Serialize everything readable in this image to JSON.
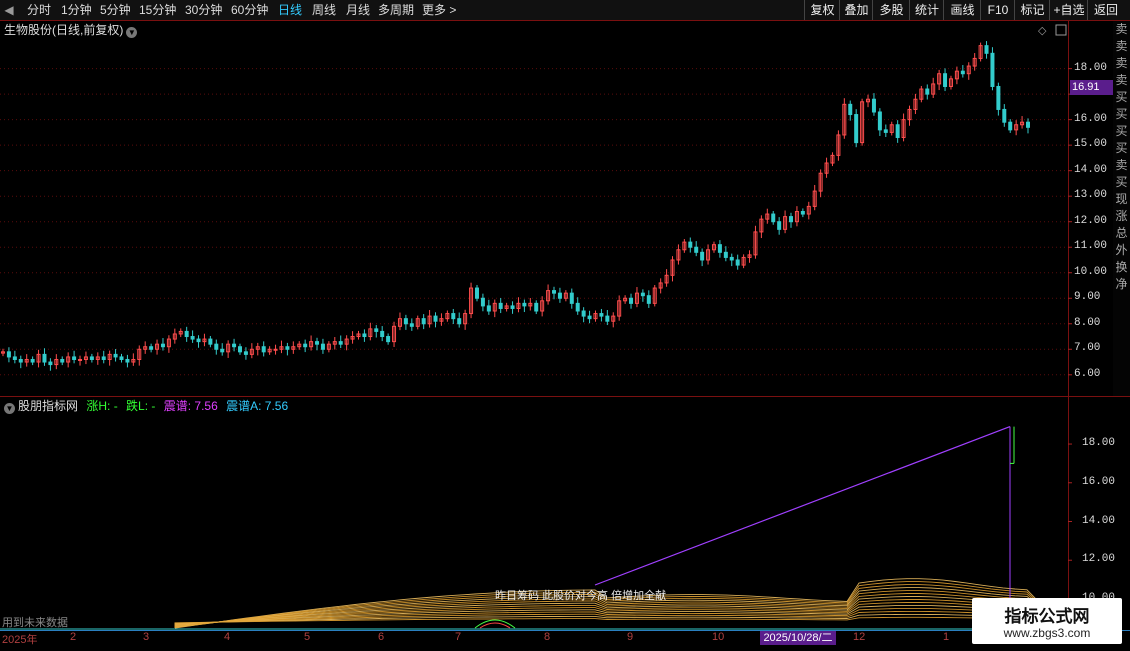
{
  "toolbar": {
    "periods": [
      "分时",
      "1分钟",
      "5分钟",
      "15分钟",
      "30分钟",
      "60分钟",
      "日线",
      "周线",
      "月线",
      "多周期",
      "更多 >"
    ],
    "active_period": "日线",
    "right_buttons": [
      "复权",
      "叠加",
      "多股",
      "统计",
      "画线",
      "F10",
      "标记",
      "+自选",
      "返回"
    ]
  },
  "main_chart": {
    "title": "生物股份(日线,前复权)",
    "current_price": "16.91",
    "y_ticks": [
      "18.00",
      "17.00",
      "16.00",
      "15.00",
      "14.00",
      "13.00",
      "12.00",
      "11.00",
      "10.00",
      "9.00",
      "8.00",
      "7.00",
      "6.00"
    ]
  },
  "indicator": {
    "name": "股朋指标网",
    "zh_label": "涨H: -",
    "die_label": "跌L: -",
    "zp_label": "震谱: 7.56",
    "zpa_label": "震谱A: 7.56",
    "y_ticks": [
      "18.00",
      "16.00",
      "14.00",
      "12.00",
      "10.00"
    ],
    "future_hint": "用到未来数据",
    "overlay_text": "昨日筹码 此股价对今高 倍增加全献"
  },
  "date_axis": {
    "ticks": [
      "2025年",
      "2",
      "3",
      "4",
      "5",
      "6",
      "7",
      "8",
      "9",
      "10",
      "12",
      "1"
    ],
    "selected_date": "2025/10/28/二"
  },
  "right_strip_chars": [
    "卖",
    "卖",
    "卖",
    "卖",
    "买",
    "买",
    "买",
    "买",
    "卖",
    "买",
    "现",
    "涨",
    "总",
    "外",
    "换",
    "净"
  ],
  "watermark": {
    "title": "指标公式网",
    "url": "www.zbgs3.com"
  },
  "colors": {
    "up": "#ff4d4d",
    "down": "#33cccc",
    "purple_line": "#a040ff",
    "band": "#e0a030",
    "accent": "#5a1d8c"
  },
  "chart_data": {
    "type": "candlestick",
    "title": "生物股份(日线,前复权)",
    "ylim": [
      5.6,
      19.2
    ],
    "closes": [
      6.9,
      6.7,
      6.6,
      6.5,
      6.6,
      6.5,
      6.8,
      6.5,
      6.4,
      6.6,
      6.5,
      6.7,
      6.6,
      6.6,
      6.7,
      6.6,
      6.7,
      6.6,
      6.8,
      6.7,
      6.6,
      6.5,
      6.6,
      7.0,
      7.1,
      7.0,
      7.2,
      7.1,
      7.4,
      7.6,
      7.7,
      7.5,
      7.4,
      7.3,
      7.4,
      7.2,
      7.0,
      6.9,
      7.2,
      7.1,
      6.9,
      6.8,
      7.0,
      7.1,
      6.9,
      7.0,
      7.0,
      7.1,
      7.0,
      7.1,
      7.2,
      7.1,
      7.3,
      7.2,
      7.0,
      7.2,
      7.3,
      7.2,
      7.4,
      7.5,
      7.6,
      7.5,
      7.8,
      7.7,
      7.5,
      7.3,
      7.9,
      8.2,
      8.0,
      7.9,
      8.2,
      8.0,
      8.3,
      8.1,
      8.2,
      8.4,
      8.2,
      8.0,
      8.4,
      9.4,
      9.0,
      8.7,
      8.5,
      8.8,
      8.6,
      8.7,
      8.6,
      8.8,
      8.7,
      8.8,
      8.5,
      8.9,
      9.3,
      9.2,
      9.0,
      9.2,
      8.8,
      8.5,
      8.3,
      8.2,
      8.4,
      8.3,
      8.1,
      8.3,
      8.9,
      9.0,
      8.8,
      9.2,
      9.1,
      8.8,
      9.4,
      9.6,
      9.9,
      10.5,
      10.9,
      11.2,
      11.0,
      10.8,
      10.5,
      10.9,
      11.1,
      10.8,
      10.6,
      10.5,
      10.3,
      10.6,
      10.7,
      11.6,
      12.1,
      12.3,
      12.0,
      11.7,
      12.2,
      12.0,
      12.4,
      12.3,
      12.6,
      13.2,
      13.9,
      14.3,
      14.6,
      15.4,
      16.6,
      16.2,
      15.1,
      16.7,
      16.8,
      16.3,
      15.6,
      15.5,
      15.8,
      15.3,
      16.0,
      16.4,
      16.8,
      17.2,
      17.0,
      17.4,
      17.8,
      17.3,
      17.6,
      17.9,
      17.8,
      18.1,
      18.4,
      18.9,
      18.6,
      17.3,
      16.4,
      15.9,
      15.6,
      15.8,
      15.9,
      15.7
    ]
  }
}
